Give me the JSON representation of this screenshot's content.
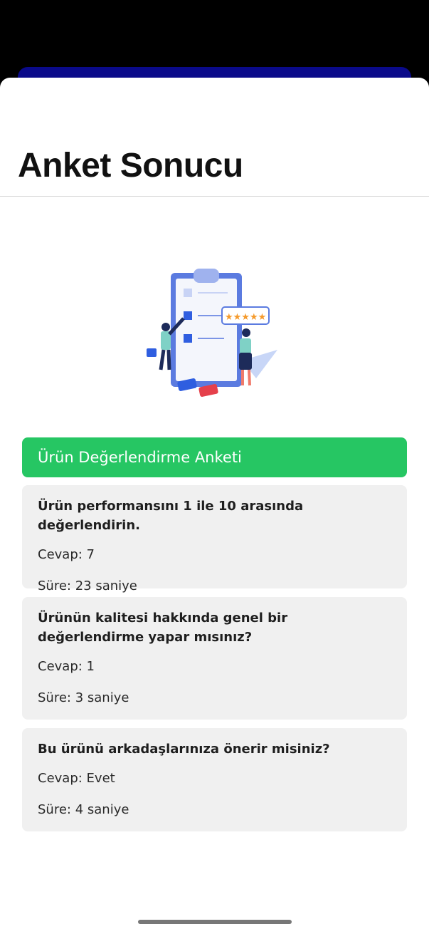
{
  "page": {
    "title": "Anket Sonucu"
  },
  "survey": {
    "title": "Ürün Değerlendirme Anketi",
    "questions": [
      {
        "question": "Ürün performansını 1 ile 10 arasında değerlendirin.",
        "answer": "Cevap: 7",
        "duration": "Süre: 23 saniye"
      },
      {
        "question": "Ürünün kalitesi hakkında genel bir değerlendirme yapar mısınız?",
        "answer": "Cevap: 1",
        "duration": "Süre: 3 saniye"
      },
      {
        "question": "Bu ürünü arkadaşlarınıza önerir misiniz?",
        "answer": "Cevap: Evet",
        "duration": "Süre: 4 saniye"
      }
    ]
  },
  "colors": {
    "accent": "#26c663",
    "card": "#f0f0f0",
    "backdrop": "#0a0a8a"
  }
}
